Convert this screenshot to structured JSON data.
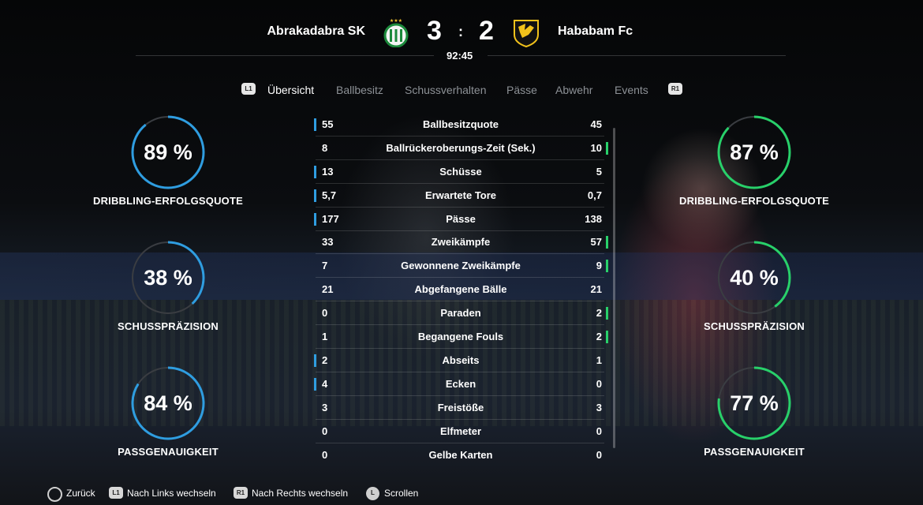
{
  "match": {
    "home_team": "Abrakadabra SK",
    "away_team": "Hababam Fc",
    "home_score": "3",
    "away_score": "2",
    "separator": ":",
    "clock": "92:45"
  },
  "tabs": {
    "prev_button": "L1",
    "next_button": "R1",
    "items": [
      "Übersicht",
      "Ballbesitz",
      "Schussverhalten",
      "Pässe",
      "Abwehr",
      "Events"
    ],
    "active": "Übersicht"
  },
  "home_circles": [
    {
      "value": "89 %",
      "fraction": 0.89,
      "label": "DRIBBLING-ERFOLGSQUOTE"
    },
    {
      "value": "38 %",
      "fraction": 0.38,
      "label": "SCHUSSPRÄZISION"
    },
    {
      "value": "84 %",
      "fraction": 0.84,
      "label": "PASSGENAUIGKEIT"
    }
  ],
  "away_circles": [
    {
      "value": "87 %",
      "fraction": 0.87,
      "label": "DRIBBLING-ERFOLGSQUOTE"
    },
    {
      "value": "40 %",
      "fraction": 0.4,
      "label": "SCHUSSPRÄZISION"
    },
    {
      "value": "77 %",
      "fraction": 0.77,
      "label": "PASSGENAUIGKEIT"
    }
  ],
  "stats": [
    {
      "home": "55",
      "name": "Ballbesitzquote",
      "away": "45",
      "leader": "home"
    },
    {
      "home": "8",
      "name": "Ballrückeroberungs-Zeit (Sek.)",
      "away": "10",
      "leader": "away"
    },
    {
      "home": "13",
      "name": "Schüsse",
      "away": "5",
      "leader": "home"
    },
    {
      "home": "5,7",
      "name": "Erwartete Tore",
      "away": "0,7",
      "leader": "home"
    },
    {
      "home": "177",
      "name": "Pässe",
      "away": "138",
      "leader": "home"
    },
    {
      "home": "33",
      "name": "Zweikämpfe",
      "away": "57",
      "leader": "away"
    },
    {
      "home": "7",
      "name": "Gewonnene Zweikämpfe",
      "away": "9",
      "leader": "away"
    },
    {
      "home": "21",
      "name": "Abgefangene Bälle",
      "away": "21",
      "leader": "none"
    },
    {
      "home": "0",
      "name": "Paraden",
      "away": "2",
      "leader": "away"
    },
    {
      "home": "1",
      "name": "Begangene Fouls",
      "away": "2",
      "leader": "away"
    },
    {
      "home": "2",
      "name": "Abseits",
      "away": "1",
      "leader": "home"
    },
    {
      "home": "4",
      "name": "Ecken",
      "away": "0",
      "leader": "home"
    },
    {
      "home": "3",
      "name": "Freistöße",
      "away": "3",
      "leader": "none"
    },
    {
      "home": "0",
      "name": "Elfmeter",
      "away": "0",
      "leader": "none"
    },
    {
      "home": "0",
      "name": "Gelbe Karten",
      "away": "0",
      "leader": "none"
    }
  ],
  "footer": {
    "back": "Zurück",
    "prev_label": "L1",
    "prev": "Nach Links wechseln",
    "next_label": "R1",
    "next": "Nach Rechts wechseln",
    "scroll_label": "L",
    "scroll": "Scrollen"
  },
  "colors": {
    "home_accent": "#2f9de0",
    "away_accent": "#28d06a",
    "ring_track": "#3a3d42"
  }
}
